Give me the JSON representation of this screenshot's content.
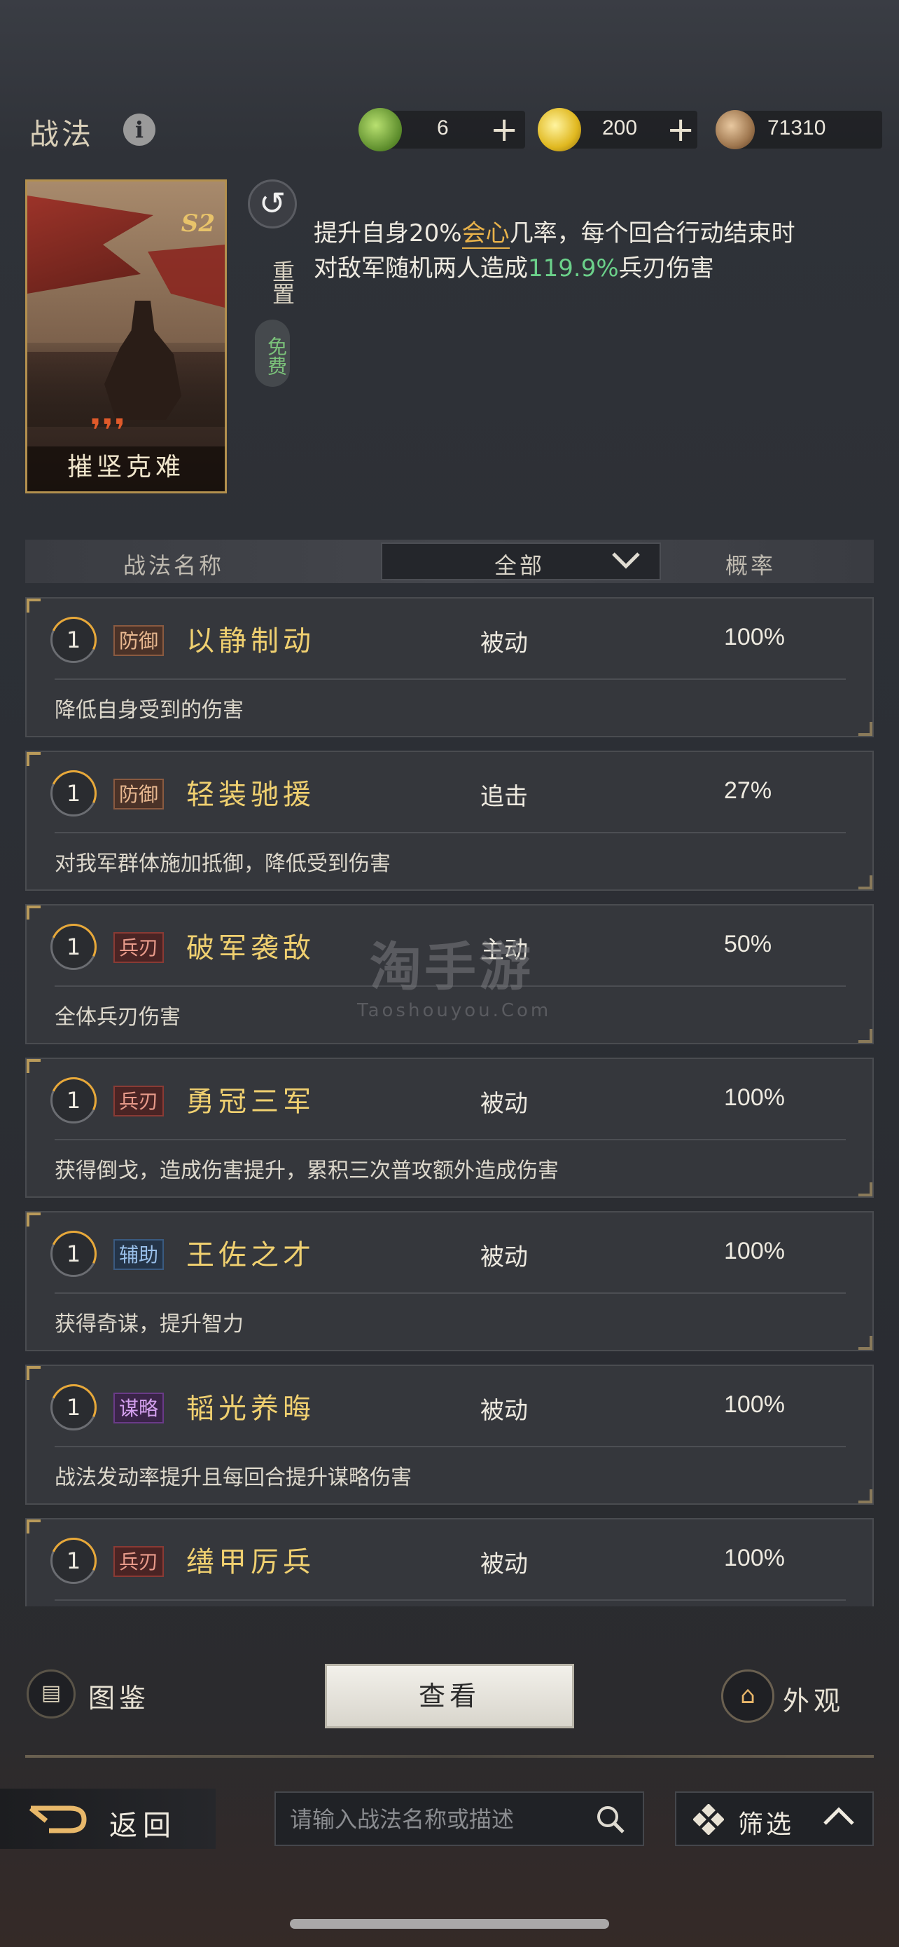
{
  "header": {
    "title": "战法",
    "info_icon": "info-icon",
    "currencies": [
      {
        "icon": "jade-coin-icon",
        "value": "6",
        "plus": "+"
      },
      {
        "icon": "gold-coin-icon",
        "value": "200",
        "plus": "+"
      },
      {
        "icon": "copper-coin-icon",
        "value": "71310"
      }
    ]
  },
  "card": {
    "name": "摧坚克难",
    "badge": "S2",
    "claws": "❜❜❜"
  },
  "reset": {
    "label": "重置",
    "free_label": "免费"
  },
  "description": {
    "part1": "提升自身20%",
    "highlight1": "会心",
    "part2": "几率，每个回合行动结束时对敌军随机两人造成",
    "highlight2": "119.9%",
    "part3": "兵刃伤害"
  },
  "table_header": {
    "col_name": "战法名称",
    "filter_value": "全部",
    "col_rate": "概率"
  },
  "skills": [
    {
      "level": "1",
      "tag": "防御",
      "tag_class": "def",
      "name": "以静制动",
      "type": "被动",
      "rate": "100%",
      "desc": "降低自身受到的伤害"
    },
    {
      "level": "1",
      "tag": "防御",
      "tag_class": "def",
      "name": "轻装驰援",
      "type": "追击",
      "rate": "27%",
      "desc": "对我军群体施加抵御，降低受到伤害"
    },
    {
      "level": "1",
      "tag": "兵刃",
      "tag_class": "blade",
      "name": "破军袭敌",
      "type": "主动",
      "rate": "50%",
      "desc": "全体兵刃伤害"
    },
    {
      "level": "1",
      "tag": "兵刃",
      "tag_class": "blade",
      "name": "勇冠三军",
      "type": "被动",
      "rate": "100%",
      "desc": "获得倒戈，造成伤害提升，累积三次普攻额外造成伤害"
    },
    {
      "level": "1",
      "tag": "辅助",
      "tag_class": "aux",
      "name": "王佐之才",
      "type": "被动",
      "rate": "100%",
      "desc": "获得奇谋，提升智力"
    },
    {
      "level": "1",
      "tag": "谋略",
      "tag_class": "strat",
      "name": "韬光养晦",
      "type": "被动",
      "rate": "100%",
      "desc": "战法发动率提升且每回合提升谋略伤害"
    },
    {
      "level": "1",
      "tag": "兵刃",
      "tag_class": "blade",
      "name": "缮甲厉兵",
      "type": "被动",
      "rate": "100%",
      "desc": ""
    }
  ],
  "watermark": {
    "big": "淘手游",
    "small": "Taoshouyou.Com"
  },
  "bottom": {
    "codex_label": "图鉴",
    "view_label": "查看",
    "appearance_label": "外观",
    "back_label": "返回",
    "search_placeholder": "请输入战法名称或描述",
    "filter_label": "筛选"
  }
}
